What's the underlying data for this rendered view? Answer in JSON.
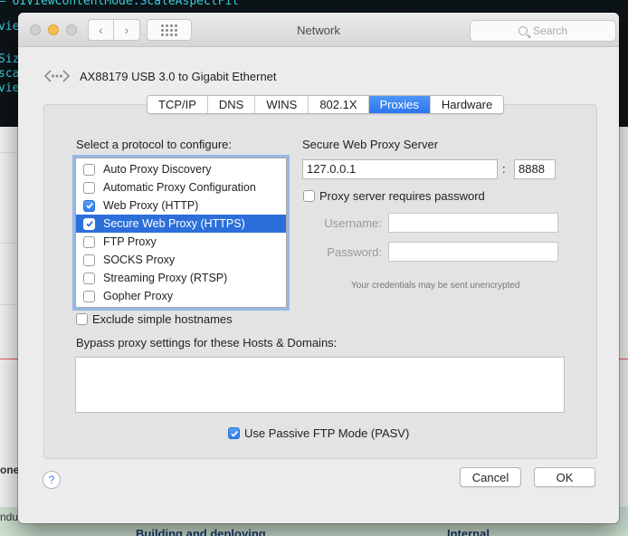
{
  "background": {
    "code_lines": [
      "– UIViewContentMode.ScaleAspectFit",
      "vie",
      "Siz",
      "sca",
      "view"
    ],
    "left_clip_one": "one",
    "left_clip_indu": "ndu",
    "strip_texts": [
      "Building and deploying",
      "Internal"
    ]
  },
  "window": {
    "title": "Network",
    "search_placeholder": "Search",
    "nav_back": "‹",
    "nav_forward": "›"
  },
  "interface": {
    "name": "AX88179 USB 3.0 to Gigabit Ethernet"
  },
  "tabs": [
    {
      "label": "TCP/IP",
      "active": false
    },
    {
      "label": "DNS",
      "active": false
    },
    {
      "label": "WINS",
      "active": false
    },
    {
      "label": "802.1X",
      "active": false
    },
    {
      "label": "Proxies",
      "active": true
    },
    {
      "label": "Hardware",
      "active": false
    }
  ],
  "protocols": {
    "heading": "Select a protocol to configure:",
    "items": [
      {
        "label": "Auto Proxy Discovery",
        "checked": false,
        "selected": false
      },
      {
        "label": "Automatic Proxy Configuration",
        "checked": false,
        "selected": false
      },
      {
        "label": "Web Proxy (HTTP)",
        "checked": true,
        "selected": false
      },
      {
        "label": "Secure Web Proxy (HTTPS)",
        "checked": true,
        "selected": true
      },
      {
        "label": "FTP Proxy",
        "checked": false,
        "selected": false
      },
      {
        "label": "SOCKS Proxy",
        "checked": false,
        "selected": false
      },
      {
        "label": "Streaming Proxy (RTSP)",
        "checked": false,
        "selected": false
      },
      {
        "label": "Gopher Proxy",
        "checked": false,
        "selected": false
      }
    ]
  },
  "server": {
    "heading": "Secure Web Proxy Server",
    "host": "127.0.0.1",
    "port_separator": ":",
    "port": "8888",
    "requires_password_label": "Proxy server requires password",
    "requires_password": false,
    "username_label": "Username:",
    "username_value": "",
    "password_label": "Password:",
    "password_value": "",
    "credentials_note": "Your credentials may be sent unencrypted"
  },
  "exclude_simple": {
    "label": "Exclude simple hostnames",
    "checked": false
  },
  "bypass": {
    "heading": "Bypass proxy settings for these Hosts & Domains:",
    "value": ""
  },
  "passive_ftp": {
    "label": "Use Passive FTP Mode (PASV)",
    "checked": true
  },
  "buttons": {
    "help": "?",
    "cancel": "Cancel",
    "ok": "OK"
  },
  "colors": {
    "accent": "#2c6fdb",
    "tab_active": "#3b82f6"
  }
}
